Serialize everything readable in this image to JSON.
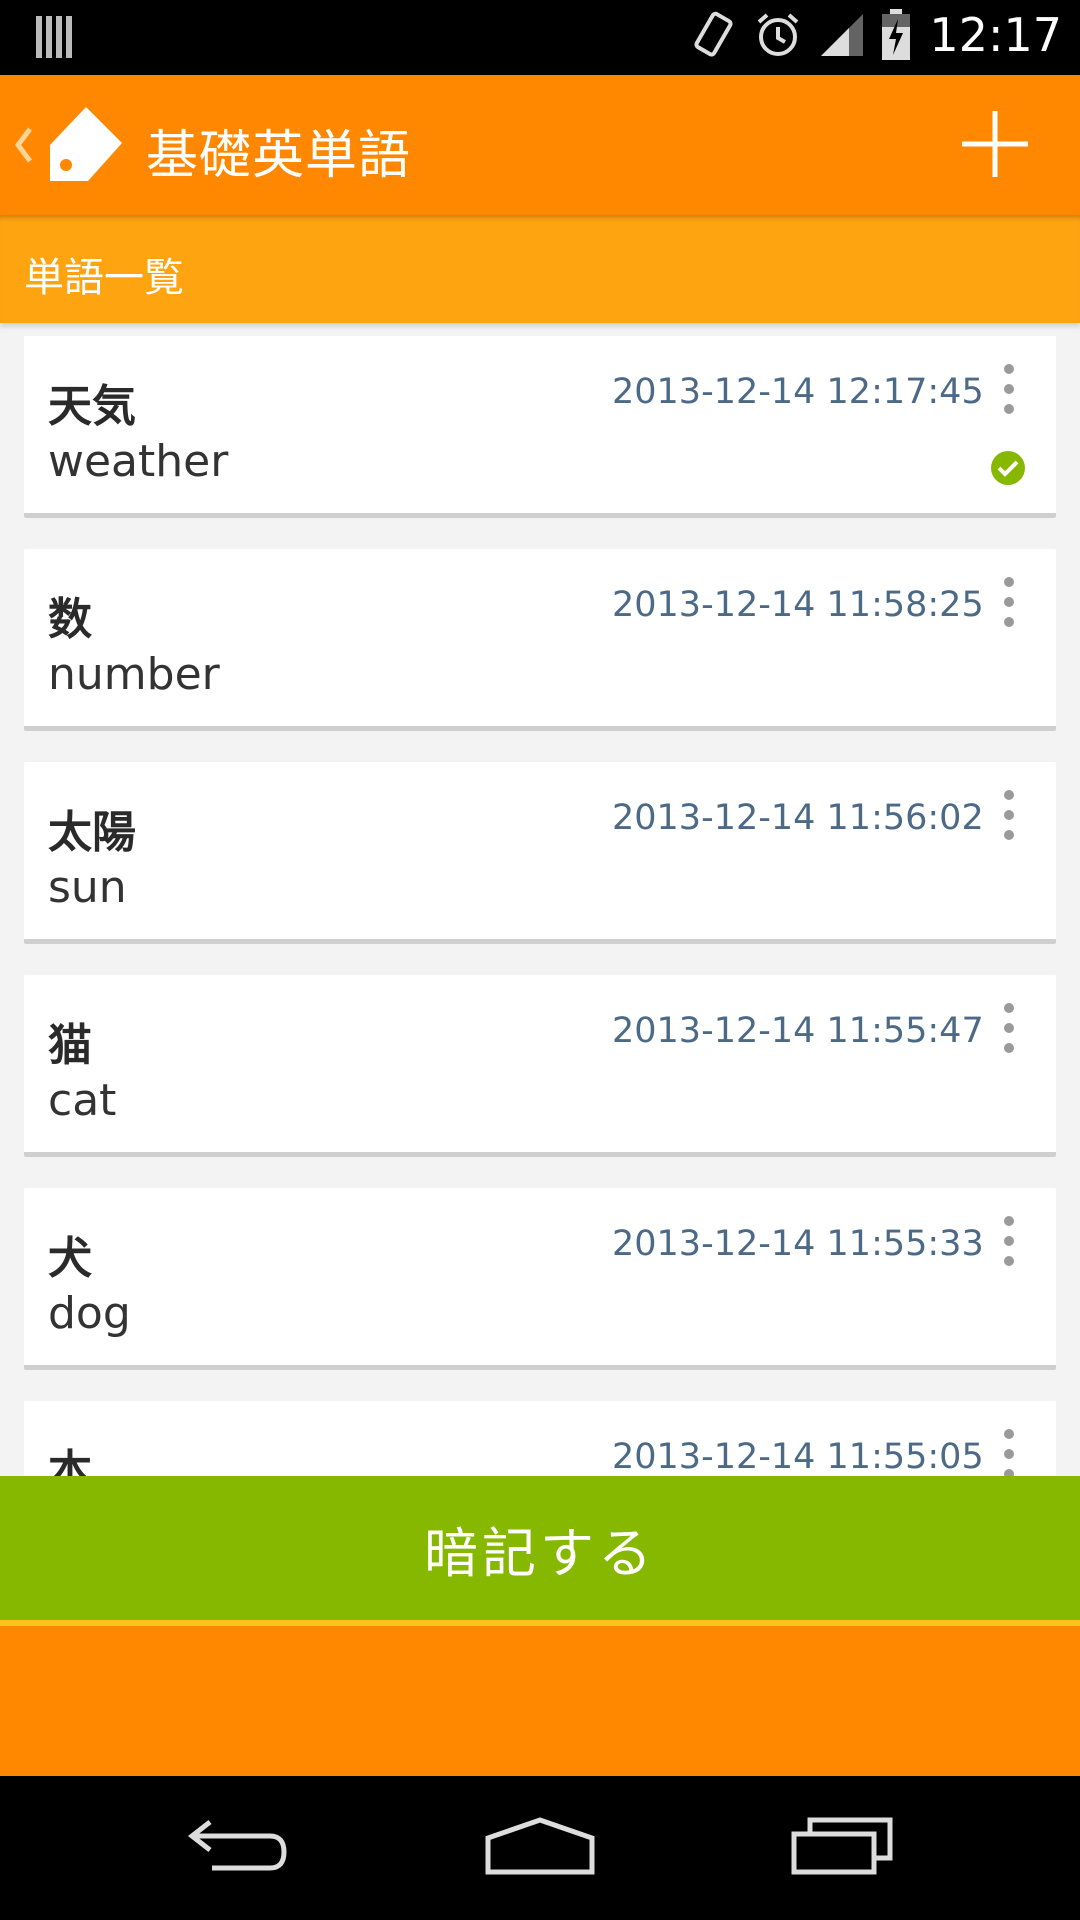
{
  "status_bar": {
    "time": "12:17",
    "icons": [
      "barcode-icon",
      "vibrate-icon",
      "alarm-icon",
      "signal-icon",
      "battery-charging-icon"
    ]
  },
  "action_bar": {
    "title": "基礎英単語",
    "back_icon": "chevron-left-icon",
    "logo_icon": "tag-icon",
    "add_icon": "plus-icon"
  },
  "sub_header": {
    "label": "単語一覧"
  },
  "words": [
    {
      "jp": "天気",
      "en": "weather",
      "timestamp": "2013-12-14 12:17:45",
      "checked": true
    },
    {
      "jp": "数",
      "en": "number",
      "timestamp": "2013-12-14 11:58:25",
      "checked": false
    },
    {
      "jp": "太陽",
      "en": "sun",
      "timestamp": "2013-12-14 11:56:02",
      "checked": false
    },
    {
      "jp": "猫",
      "en": "cat",
      "timestamp": "2013-12-14 11:55:47",
      "checked": false
    },
    {
      "jp": "犬",
      "en": "dog",
      "timestamp": "2013-12-14 11:55:33",
      "checked": false
    },
    {
      "jp": "本",
      "en": "",
      "timestamp": "2013-12-14 11:55:05",
      "checked": false
    }
  ],
  "memorize_button": {
    "label": "暗記する"
  },
  "colors": {
    "action_bar": "#ff8800",
    "sub_header": "#ffa411",
    "button": "#86b800",
    "check": "#86b800",
    "timestamp": "#4c6a86"
  },
  "nav_bar": {
    "icons": [
      "back-icon",
      "home-icon",
      "recent-apps-icon"
    ]
  }
}
